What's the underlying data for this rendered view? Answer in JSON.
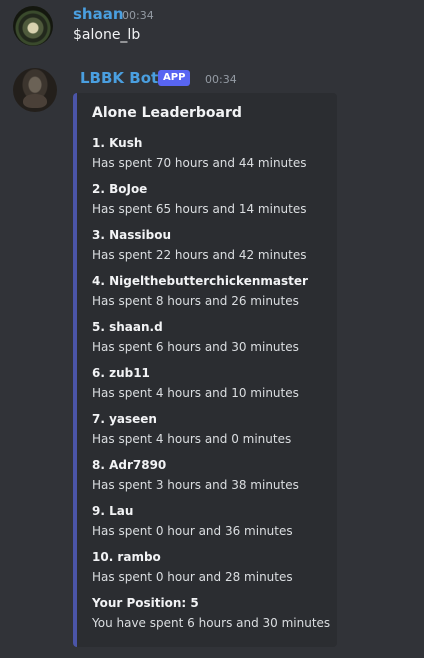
{
  "messages": [
    {
      "author": "shaan",
      "timestamp": "00:34",
      "content": "$alone_lb"
    },
    {
      "author": "LBBK Bot",
      "badge": "APP",
      "timestamp": "00:34",
      "embed": {
        "title": "Alone Leaderboard",
        "entries": [
          {
            "name": "1. Kush",
            "detail": "Has spent 70 hours and 44 minutes"
          },
          {
            "name": "2. BoJoe",
            "detail": "Has spent 65 hours and 14 minutes"
          },
          {
            "name": "3. Nassibou",
            "detail": "Has spent 22 hours and 42 minutes"
          },
          {
            "name": "4. Nigelthebutterchickenmaster",
            "detail": "Has spent 8 hours and 26 minutes"
          },
          {
            "name": "5. shaan.d",
            "detail": "Has spent 6 hours and 30 minutes"
          },
          {
            "name": "6. zub11",
            "detail": "Has spent 4 hours and 10 minutes"
          },
          {
            "name": "7. yaseen",
            "detail": "Has spent 4 hours and 0 minutes"
          },
          {
            "name": "8. Adr7890",
            "detail": "Has spent 3 hours and 38 minutes"
          },
          {
            "name": "9. Lau",
            "detail": "Has spent 0 hour and 36 minutes"
          },
          {
            "name": "10. rambo",
            "detail": "Has spent 0 hour and 28 minutes"
          },
          {
            "name": "Your Position: 5",
            "detail": "You have spent 6 hours and 30 minutes"
          }
        ]
      }
    }
  ],
  "colors": {
    "background": "#313338",
    "username": "#4a9fe0",
    "app_badge": "#5865f2",
    "embed_bg": "#2b2d31",
    "embed_accent": "#4b55a8"
  }
}
